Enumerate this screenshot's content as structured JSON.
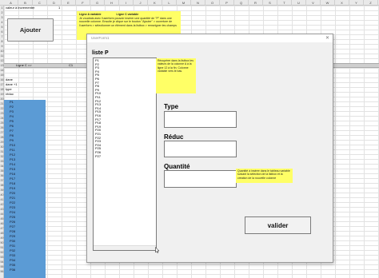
{
  "columns": [
    "A",
    "B",
    "C",
    "D",
    "E",
    "F",
    "G",
    "H",
    "I",
    "J",
    "K",
    "L",
    "M",
    "N",
    "O",
    "P",
    "Q",
    "R",
    "S",
    "T",
    "U",
    "V",
    "W",
    "X",
    "Y",
    "Z"
  ],
  "rows": [
    "1",
    "2",
    "3",
    "4",
    "5",
    "6",
    "7",
    "8",
    "9",
    "10",
    "11",
    "12",
    "13",
    "14",
    "15",
    "16",
    "17",
    "18",
    "19",
    "20",
    "21",
    "22",
    "23",
    "24",
    "25",
    "26",
    "27",
    "28",
    "29",
    "30",
    "31",
    "32",
    "33",
    "34",
    "35",
    "36",
    "37",
    "38",
    "39",
    "40",
    "41",
    "42",
    "43",
    "44",
    "45",
    "46",
    "47",
    "48",
    "49",
    "50",
    "51",
    "52",
    "53",
    "54",
    "55",
    "56"
  ],
  "cells": {
    "a1": "valeur à incrementer",
    "b1": "1",
    "row5_a": "Ligne C =>",
    "row5_c": "C1",
    "r8": "dane",
    "r9": "dane +1",
    "r10": "type",
    "r11": "réduc"
  },
  "ajouter_button": "Ajouter",
  "note_top": {
    "title1": "Ligne A variable",
    "title2": "Ligne C variable",
    "body": "Je voudrais avec l'userform pouvoir insérer une quantité de \"P\" dans une nouvelle colonne. Ensuite je clique sur le bouton \"Ajouter\" > ouverture de l'userform > sélectionner un élément dans la listbox > renseigner les champs"
  },
  "right_note": "Incrémente de 1 la ligne C (S) pour créer une nouvelle colonne et l'insérer",
  "blue_rows": [
    "P1",
    "P2",
    "P3",
    "P4",
    "P5",
    "P6",
    "P7",
    "P8",
    "P9",
    "P10",
    "P11",
    "P12",
    "P13",
    "P14",
    "P15",
    "P16",
    "P17",
    "P18",
    "P19",
    "P20",
    "P21",
    "P22",
    "P23",
    "P24",
    "P25",
    "P26",
    "P27",
    "P28",
    "P29",
    "P30",
    "P31",
    "P32",
    "P33",
    "P34",
    "P35",
    "P36"
  ],
  "userform": {
    "title": "UserForm1",
    "close": "✕",
    "list_label": "liste P",
    "list_items": [
      "P1",
      "P2",
      "P3",
      "P4",
      "P5",
      "P6",
      "P7",
      "P8",
      "P9",
      "P10",
      "P11",
      "P12",
      "P13",
      "P14",
      "P15",
      "P16",
      "P17",
      "P18",
      "P19",
      "P20",
      "P21",
      "P22",
      "P23",
      "P24",
      "P25",
      "P26",
      "P27"
    ],
    "listbox_note": "Récupérer dans la listbox les valeurs de la colonne A à la ligne 12 à la fin. Colonne variable vers le bas.",
    "type_label": "Type",
    "type_value": "",
    "reduc_label": "Réduc",
    "reduc_value": "",
    "quantite_label": "Quantité",
    "quantite_value": "",
    "quantite_note": "Quantité à insérer dans le tableau variable suivant la sélection de la listbox et la création de la nouvelle colonne",
    "valider_label": "valider"
  },
  "colors": {
    "yellow_note": "#ffff66",
    "pink_cell": "#f08a8a",
    "blue_column": "#5b9bd5",
    "form_bg": "#f0f0f0"
  }
}
